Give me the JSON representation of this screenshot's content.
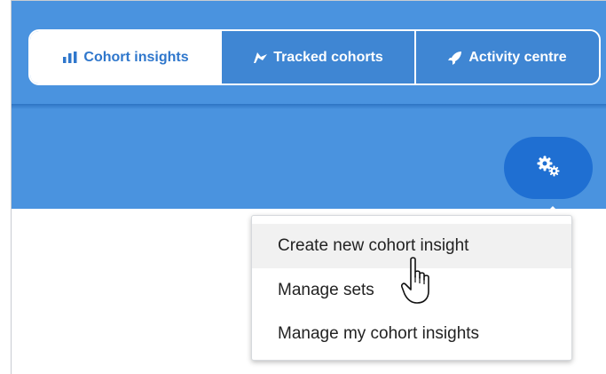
{
  "nav": {
    "tabs": [
      {
        "label": "Cohort insights",
        "icon": "bar-chart-icon",
        "active": true
      },
      {
        "label": "Tracked cohorts",
        "icon": "flag-icon",
        "active": false
      },
      {
        "label": "Activity centre",
        "icon": "rocket-icon",
        "active": false
      }
    ]
  },
  "settings": {
    "icon": "gears-icon"
  },
  "menu": {
    "items": [
      {
        "label": "Create new cohort insight",
        "hovered": true
      },
      {
        "label": "Manage sets",
        "hovered": false
      },
      {
        "label": "Manage my cohort insights",
        "hovered": false
      }
    ]
  },
  "cursor": {
    "icon": "hand-pointer-icon"
  },
  "colors": {
    "header": "#4a93df",
    "active_tab_text": "#2f77cc",
    "inactive_tab_bg": "#3f86d3",
    "gear_button": "#1f6fd2",
    "menu_hover": "#f1f1f1"
  }
}
